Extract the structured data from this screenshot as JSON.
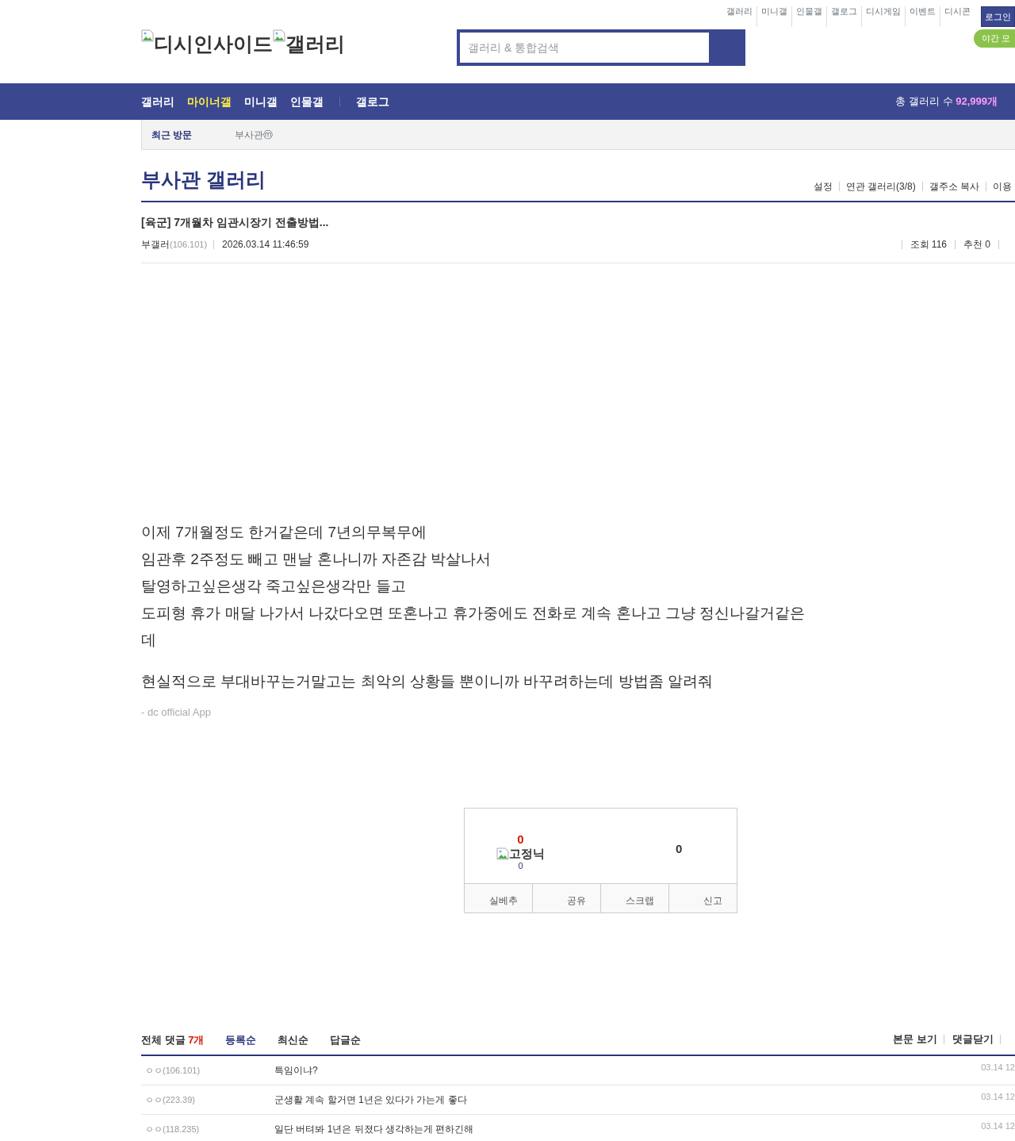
{
  "top_links": [
    "갤러리",
    "미니갤",
    "인물갤",
    "갤로그",
    "디시게임",
    "이벤트",
    "디시콘"
  ],
  "login_button": "로그인",
  "night_mode_button": "야간 모",
  "logo": {
    "alt_1": "디시인사이드",
    "alt_2": "갤러리"
  },
  "search": {
    "placeholder": "갤러리 & 통합검색"
  },
  "nav": {
    "items": [
      {
        "label": "갤러리",
        "selected": false
      },
      {
        "label": "마이너갤",
        "selected": true
      },
      {
        "label": "미니갤",
        "selected": false
      },
      {
        "label": "인물갤",
        "selected": false
      },
      {
        "label": "갤로그",
        "selected": false
      }
    ],
    "total_label": "총 갤러리 수",
    "total_count": "92,999개"
  },
  "recent": {
    "label": "최근 방문",
    "items": [
      "부사관ⓜ"
    ]
  },
  "gallery": {
    "title": "부사관 갤러리",
    "tools": [
      "설정",
      "연관 갤러리(3/8)",
      "갤주소 복사",
      "이용"
    ]
  },
  "post": {
    "title": "[육군] 7개월차 임관시장기 전출방법...",
    "author": "부갤러",
    "ip": "(106.101)",
    "date": "2026.03.14 11:46:59",
    "views": "조회 116",
    "recommend": "추천 0",
    "paragraphs": [
      [
        "이제 7개월정도 한거같은데 7년의무복무에",
        "임관후 2주정도 빼고 맨날 혼나니까 자존감 박살나서",
        "탈영하고싶은생각 죽고싶은생각만 들고",
        "도피형 휴가 매달 나가서 나갔다오면 또혼나고 휴가중에도 전화로 계속 혼나고 그냥 정신나갈거같은데"
      ],
      [
        "현실적으로 부대바꾸는거말고는 최악의 상황들 뿐이니까 바꾸려하는데 방법좀 알려줘"
      ]
    ],
    "signature": "- dc official App"
  },
  "vote": {
    "up_count": "0",
    "fixed_nick_label": "고정닉",
    "fixed_count": "0",
    "down_count": "0",
    "buttons": [
      "실베추",
      "공유",
      "스크랩",
      "신고"
    ]
  },
  "comments": {
    "total_label": "전체 댓글",
    "total_count": "7개",
    "sorts": [
      {
        "label": "등록순",
        "selected": true
      },
      {
        "label": "최신순",
        "selected": false
      },
      {
        "label": "답글순",
        "selected": false
      }
    ],
    "links": [
      "본문 보기",
      "댓글닫기"
    ],
    "rows": [
      {
        "author": "ㅇㅇ",
        "ip": "(106.101)",
        "text": "특임이냐?",
        "date": "03.14 12"
      },
      {
        "author": "ㅇㅇ",
        "ip": "(223.39)",
        "text": "군생활 계속 할거면 1년은 있다가 가는게 좋다",
        "date": "03.14 12"
      },
      {
        "author": "ㅇㅇ",
        "ip": "(118.235)",
        "text": "일단 버텨봐 1년은 뒤졌다 생각하는게 편하긴해",
        "date": "03.14 12"
      }
    ]
  }
}
